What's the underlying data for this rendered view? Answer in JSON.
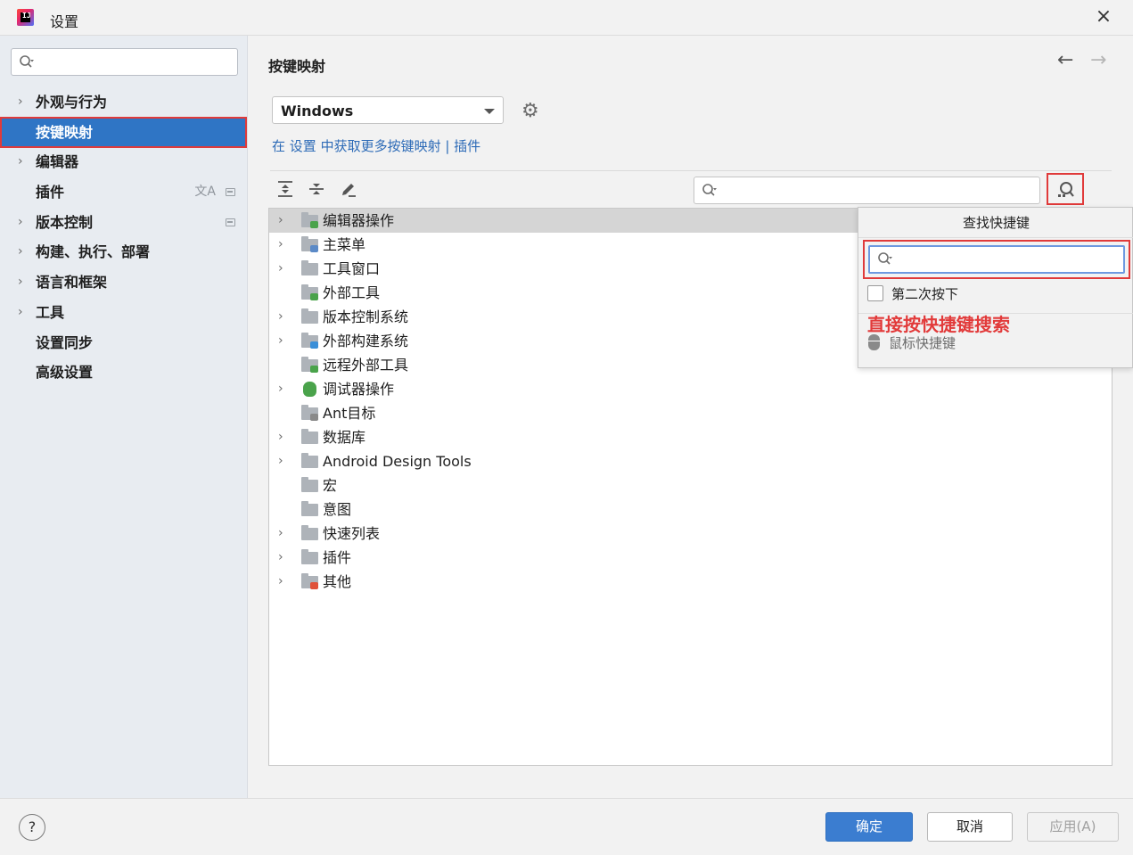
{
  "window": {
    "title": "设置",
    "close_icon": "×"
  },
  "sidebar": {
    "search_placeholder": "",
    "items": [
      {
        "label": "外观与行为",
        "expandable": true
      },
      {
        "label": "按键映射",
        "expandable": false,
        "selected": true
      },
      {
        "label": "编辑器",
        "expandable": true
      },
      {
        "label": "插件",
        "expandable": false
      },
      {
        "label": "版本控制",
        "expandable": true
      },
      {
        "label": "构建、执行、部署",
        "expandable": true
      },
      {
        "label": "语言和框架",
        "expandable": true
      },
      {
        "label": "工具",
        "expandable": true
      },
      {
        "label": "设置同步",
        "expandable": false
      },
      {
        "label": "高级设置",
        "expandable": false
      }
    ]
  },
  "main": {
    "page_title": "按键映射",
    "keymap_value": "Windows",
    "link_prefix": "在 ",
    "link_settings": "设置",
    "link_middle": " 中获取更多按键映射 | ",
    "link_plugins": "插件",
    "tree": [
      {
        "label": "编辑器操作",
        "expandable": true,
        "selected": true,
        "icon": "folder-editor-icon"
      },
      {
        "label": "主菜单",
        "expandable": true,
        "icon": "folder-menu-icon"
      },
      {
        "label": "工具窗口",
        "expandable": true,
        "icon": "folder-icon"
      },
      {
        "label": "外部工具",
        "expandable": false,
        "icon": "folder-tools-icon"
      },
      {
        "label": "版本控制系统",
        "expandable": true,
        "icon": "folder-icon"
      },
      {
        "label": "外部构建系统",
        "expandable": true,
        "icon": "folder-gear-icon"
      },
      {
        "label": "远程外部工具",
        "expandable": false,
        "icon": "folder-tools-icon"
      },
      {
        "label": "调试器操作",
        "expandable": true,
        "icon": "bug-icon"
      },
      {
        "label": "Ant目标",
        "expandable": false,
        "icon": "folder-ant-icon"
      },
      {
        "label": "数据库",
        "expandable": true,
        "icon": "folder-icon"
      },
      {
        "label": "Android Design Tools",
        "expandable": true,
        "icon": "folder-icon"
      },
      {
        "label": "宏",
        "expandable": false,
        "icon": "folder-icon"
      },
      {
        "label": "意图",
        "expandable": false,
        "icon": "folder-icon"
      },
      {
        "label": "快速列表",
        "expandable": true,
        "icon": "folder-icon"
      },
      {
        "label": "插件",
        "expandable": true,
        "icon": "folder-icon"
      },
      {
        "label": "其他",
        "expandable": true,
        "icon": "folder-other-icon"
      }
    ]
  },
  "popup": {
    "title": "查找快捷键",
    "second_stroke_label": "第二次按下",
    "annotation": "直接按快捷键搜索",
    "mouse_label": "鼠标快捷键"
  },
  "buttons": {
    "help": "?",
    "ok": "确定",
    "cancel": "取消",
    "apply": "应用(A)"
  },
  "colors": {
    "accent": "#2f75c5",
    "highlight_box": "#e03a3a",
    "link": "#2d6bb7"
  }
}
